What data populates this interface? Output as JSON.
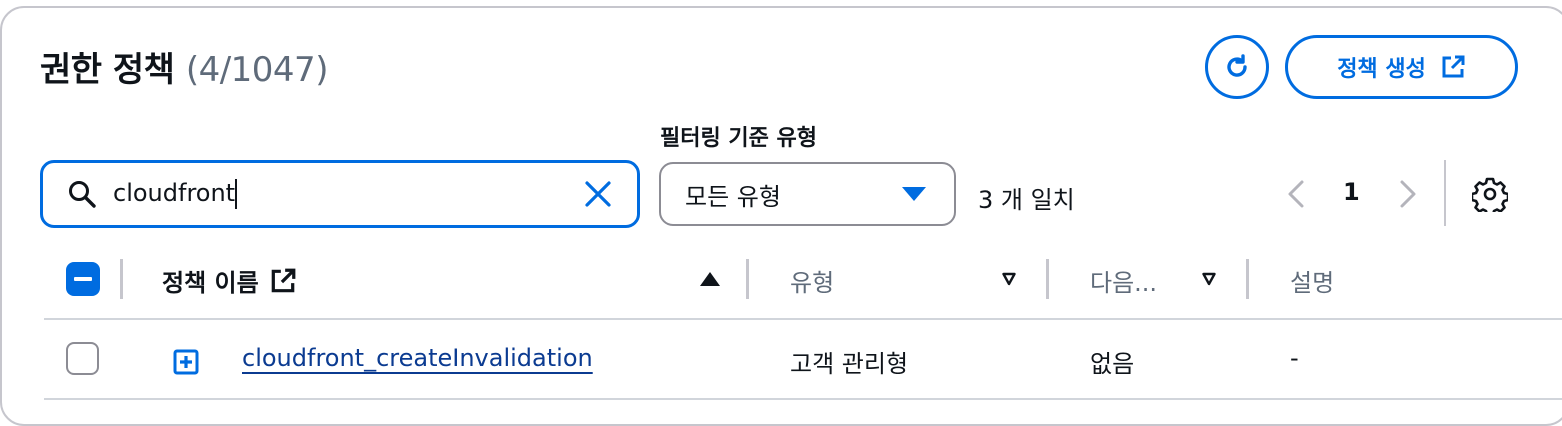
{
  "header": {
    "title": "권한 정책",
    "count": "(4/1047)",
    "create_label": "정책 생성",
    "refresh_icon": "refresh-icon",
    "external_icon": "external-link-icon"
  },
  "filter": {
    "label": "필터링 기준 유형",
    "search_value": "cloudfront",
    "type_select_value": "모든 유형",
    "match_text": "3 개 일치"
  },
  "pagination": {
    "current_page": "1"
  },
  "table": {
    "columns": [
      {
        "label": "정책 이름",
        "sort": "ascending"
      },
      {
        "label": "유형",
        "sort": "none"
      },
      {
        "label": "다음...",
        "sort": "none"
      },
      {
        "label": "설명"
      }
    ],
    "rows": [
      {
        "name": "cloudfront_createInvalidation",
        "type": "고객 관리형",
        "used_as": "없음",
        "description": "-",
        "checked": false
      }
    ]
  },
  "colors": {
    "accent": "#006ce0",
    "border": "#c6c6cd",
    "link": "#0b3b91"
  }
}
